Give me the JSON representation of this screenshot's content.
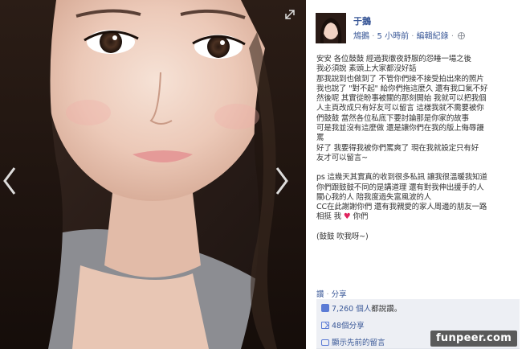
{
  "viewer": {
    "photo_alt": "selfie photo",
    "icons": [
      "chevron-left-icon",
      "chevron-right-icon",
      "expand-icon"
    ]
  },
  "post": {
    "author": "于鵝",
    "author_sub": "鴆鵝",
    "time": "5 小時前",
    "edit_history": "編輯紀錄",
    "audience_icon": "globe-icon",
    "caption": [
      "安安 各位鼓鼓 經過我徹夜舒服的怨睡一場之後",
      "我必須說 素頭上大家都沒好話",
      "那我說到也做到了 不管你們接不接受拍出來的照片",
      "我也說了 \"對不起\" 給你們拖這麼久 還有我口氣不好",
      "然後呢 其實從盼事被關的那刻開始 我就可以把我個",
      "人主頁改成只有好友可以留言 這樣我就不需要被你",
      "們鼓鼓 當然各位私底下要討論那是你家的故事",
      "可是我並沒有這麼做 還是讓你們在我的版上侮辱謾",
      "罵",
      "好了 我要得我被你們罵爽了 現在我就設定只有好",
      "友才可以留言~"
    ],
    "caption2": [
      "ps 這幾天其實真的收到很多私訊 讓我很溫暖我知道",
      "你們跟鼓鼓不同的是講道理 還有對我伸出援手的人",
      "關心我的人 陪我度過失富風波的人",
      "CC在此謝謝你們 還有我親愛的家人周邊的朋友一路",
      "相挺 我",
      "你們"
    ],
    "caption3": "(鼓鼓 吹我呀~)"
  },
  "actions": {
    "like": "讚",
    "share": "分享"
  },
  "ufi": {
    "likes_count": "7,260",
    "likes_text": "個人",
    "likes_suffix": "都說讚。",
    "shares": "48個分享",
    "view_previous": "顯示先前的留言"
  },
  "watermark": "funpeer.com",
  "colors": {
    "link": "#3b5998",
    "meta": "#90949c",
    "text": "#333333",
    "ufi_bg": "#edeff4",
    "heart": "#e0245e"
  }
}
